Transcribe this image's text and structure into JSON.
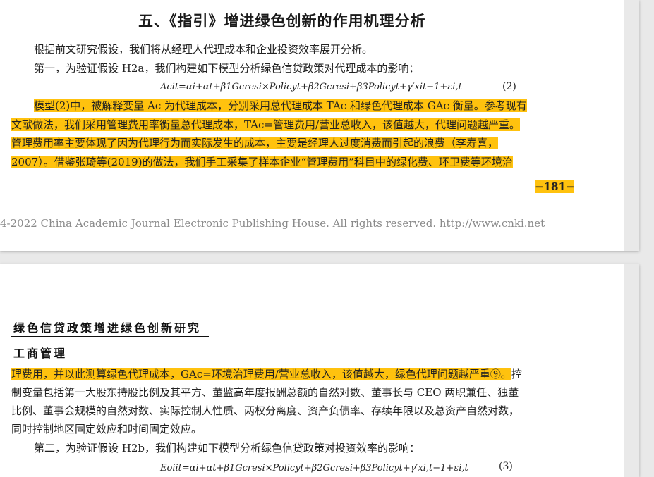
{
  "page1": {
    "section_title": "五、《指引》增进绿色创新的作用机理分析",
    "p1": "根据前文研究假设，我们将从经理人代理成本和企业投资效率展开分析。",
    "p2": "第一，为验证假设 H2a，我们构建如下模型分析绿色信贷政策对代理成本的影响：",
    "formula2": "Acit=αi+αt+β1Gcresi×Policyt+β2Gcresi+β3Policyt+γ′xit−1+εi,t",
    "eq2_number": "(2)",
    "hl_lines": [
      "模型(2)中，被解释变量 Ac 为代理成本，分别采用总代理成本 TAc 和绿色代理成本 GAc 衡量。参考现有",
      "文献做法，我们采用管理费用率衡量总代理成本，TAc=管理费用/营业总收入，该值越大，代理问题越严重。",
      "管理费用率主要体现了因为代理行为而实际发生的成本，主要是经理人过度消费而引起的浪费（李寿喜，",
      "2007）。借鉴张琦等(2019)的做法，我们手工采集了样本企业“管理费用”科目中的绿化费、环卫费等环境治"
    ],
    "page_number": "−181−",
    "copyright": "4-2022 China Academic Journal Electronic Publishing House. All rights reserved.    http://www.cnki.net"
  },
  "page2": {
    "running_title": "绿色信贷政策增进绿色创新研究",
    "journal_section": "工商管理",
    "hl_line": "理费用，并以此测算绿色代理成本，GAc=环境治理费用/营业总收入，该值越大，绿色代理问题越严重⑨。",
    "line1_rest": "控",
    "body_lines": [
      "制变量包括第一大股东持股比例及其平方、董监高年度报酬总额的自然对数、董事长与 CEO 两职兼任、独董",
      "比例、董事会规模的自然对数、实际控制人性质、两权分离度、资产负债率、存续年限以及总资产自然对数，",
      "同时控制地区固定效应和时间固定效应。"
    ],
    "p_second": "第二，为验证假设 H2b，我们构建如下模型分析绿色信贷政策对投资效率的影响：",
    "formula3": "Eoiit=αi+αt+β1Gcresi×Policyt+β2Gcresi+β3Policyt+γ′xi,t−1+εi,t",
    "eq3_number": "(3)"
  },
  "colors": {
    "highlight": "#ffc20e",
    "background": "#e9e9e9"
  }
}
